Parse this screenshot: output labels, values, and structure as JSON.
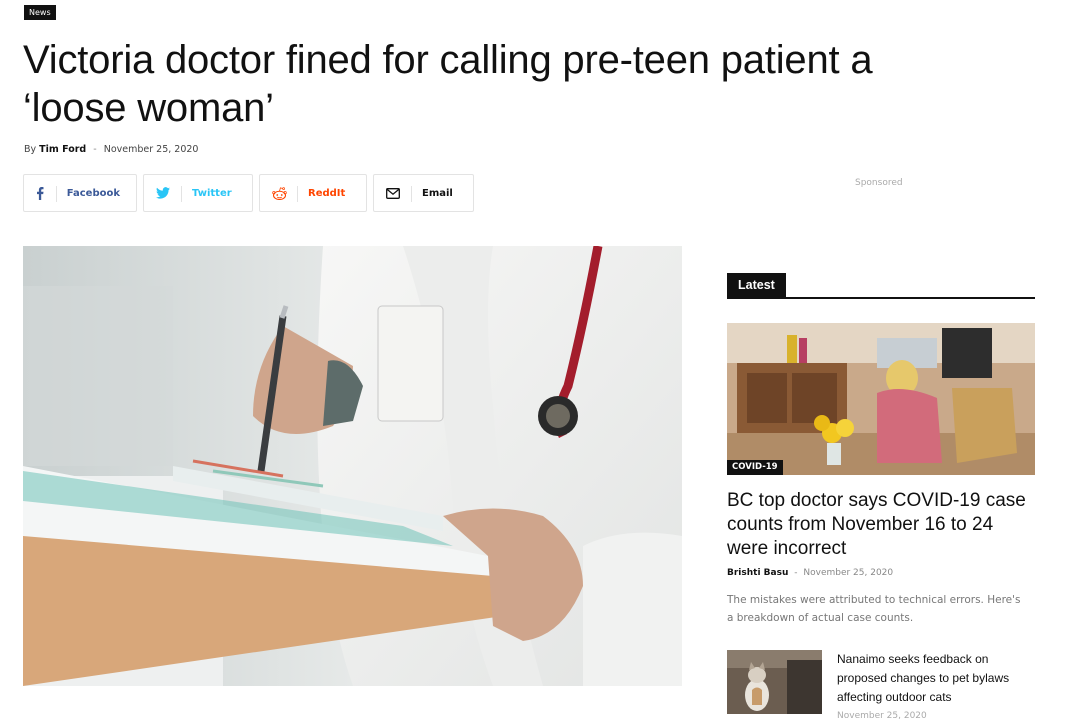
{
  "article": {
    "category": "News",
    "title": "Victoria doctor fined for calling pre-teen patient a ‘loose woman’",
    "byline_prefix": "By",
    "author": "Tim Ford",
    "date_sep": "-",
    "date": "November 25, 2020",
    "hero_image_icon": "doctor-clipboard-photo"
  },
  "share": {
    "facebook": "Facebook",
    "twitter": "Twitter",
    "reddit": "ReddIt",
    "email": "Email",
    "colors": {
      "facebook": "#3b5998",
      "twitter": "#29c5f6",
      "reddit": "#ff4500",
      "email": "#111111"
    }
  },
  "sponsored_label": "Sponsored",
  "sidebar": {
    "heading": "Latest",
    "feature": {
      "category": "COVID-19",
      "title": "BC top doctor says COVID-19 case counts from November 16 to 24 were incorrect",
      "author": "Brishti Basu",
      "sep": "-",
      "date": "November 25, 2020",
      "excerpt": "The mistakes were attributed to technical errors. Here's a breakdown of actual case counts.",
      "image_icon": "woman-at-desk-photo"
    },
    "mini": {
      "title": "Nanaimo seeks feedback on proposed changes to pet bylaws affecting outdoor cats",
      "date": "November 25, 2020",
      "image_icon": "cat-photo"
    }
  }
}
